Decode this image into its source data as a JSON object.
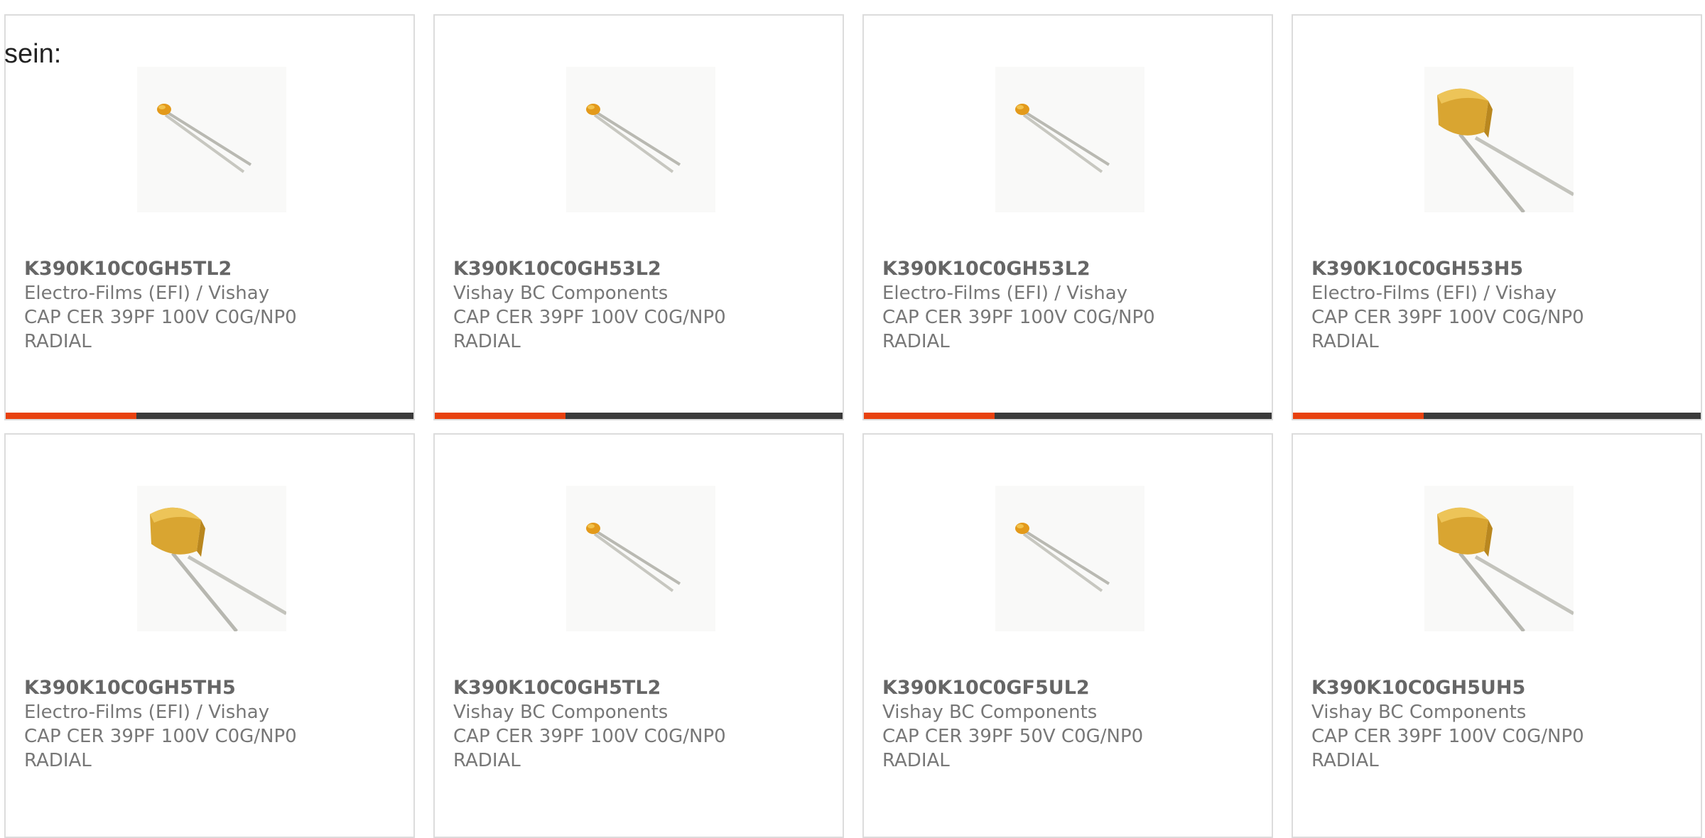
{
  "intro_text": "sein:",
  "accent_color": "#e8410f",
  "bar_track_color": "#3a3a3a",
  "products": [
    {
      "part_number": "K390K10C0GH5TL2",
      "manufacturer": "Electro-Films (EFI) / Vishay",
      "description": "CAP CER 39PF 100V C0G/NP0",
      "package": "RADIAL",
      "image": "small-disc-capacitor-icon",
      "progress": 0.32
    },
    {
      "part_number": "K390K10C0GH53L2",
      "manufacturer": "Vishay BC Components",
      "description": "CAP CER 39PF 100V C0G/NP0",
      "package": "RADIAL",
      "image": "small-disc-capacitor-icon",
      "progress": 0.32
    },
    {
      "part_number": "K390K10C0GH53L2",
      "manufacturer": "Electro-Films (EFI) / Vishay",
      "description": "CAP CER 39PF 100V C0G/NP0",
      "package": "RADIAL",
      "image": "small-disc-capacitor-icon",
      "progress": 0.32
    },
    {
      "part_number": "K390K10C0GH53H5",
      "manufacturer": "Electro-Films (EFI) / Vishay",
      "description": "CAP CER 39PF 100V C0G/NP0",
      "package": "RADIAL",
      "image": "large-capacitor-icon",
      "progress": 0.32
    },
    {
      "part_number": "K390K10C0GH5TH5",
      "manufacturer": "Electro-Films (EFI) / Vishay",
      "description": "CAP CER 39PF 100V C0G/NP0",
      "package": "RADIAL",
      "image": "large-capacitor-icon"
    },
    {
      "part_number": "K390K10C0GH5TL2",
      "manufacturer": "Vishay BC Components",
      "description": "CAP CER 39PF 100V C0G/NP0",
      "package": "RADIAL",
      "image": "small-disc-capacitor-icon"
    },
    {
      "part_number": "K390K10C0GF5UL2",
      "manufacturer": "Vishay BC Components",
      "description": "CAP CER 39PF 50V C0G/NP0",
      "package": "RADIAL",
      "image": "small-disc-capacitor-icon"
    },
    {
      "part_number": "K390K10C0GH5UH5",
      "manufacturer": "Vishay BC Components",
      "description": "CAP CER 39PF 100V C0G/NP0",
      "package": "RADIAL",
      "image": "large-capacitor-icon"
    }
  ]
}
